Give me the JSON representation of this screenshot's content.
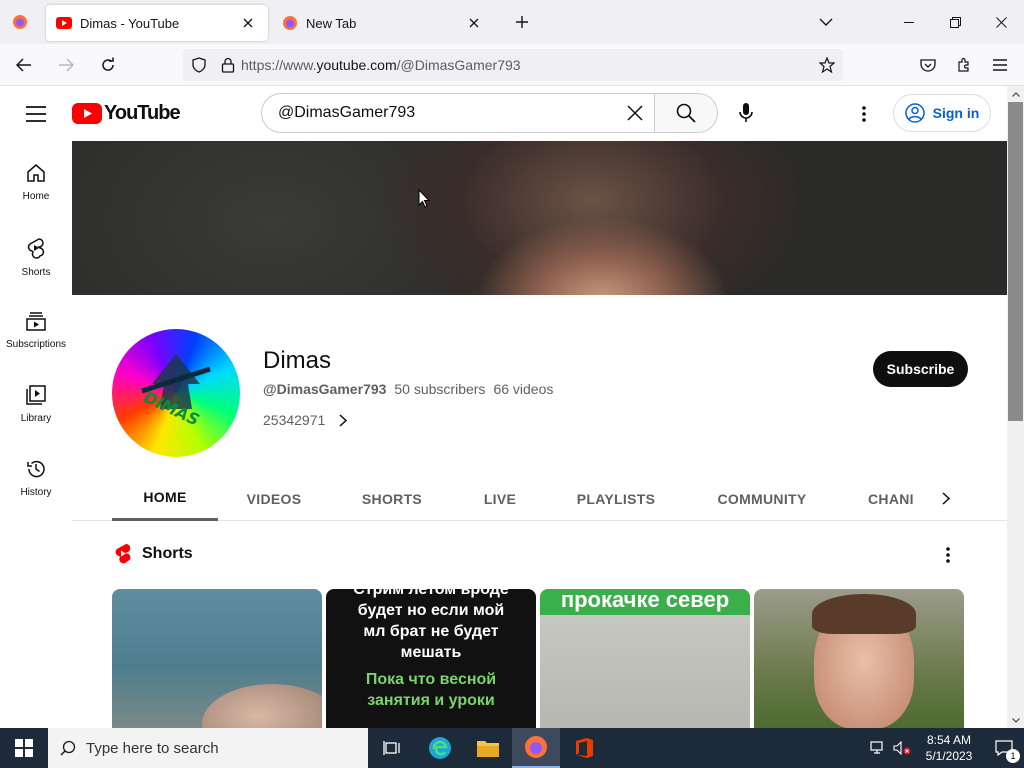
{
  "browser": {
    "tabs": [
      {
        "title": "Dimas - YouTube",
        "active": true
      },
      {
        "title": "New Tab",
        "active": false
      }
    ],
    "url": {
      "prefix": "https://www.",
      "domain": "youtube.com",
      "path": "/@DimasGamer793"
    }
  },
  "youtube": {
    "logo_text": "YouTube",
    "search_query": "@DimasGamer793",
    "signin_label": "Sign in",
    "guide": [
      {
        "label": "Home",
        "icon": "home-icon"
      },
      {
        "label": "Shorts",
        "icon": "shorts-icon"
      },
      {
        "label": "Subscriptions",
        "icon": "subscriptions-icon"
      },
      {
        "label": "Library",
        "icon": "library-icon"
      },
      {
        "label": "History",
        "icon": "history-icon"
      }
    ],
    "channel": {
      "name": "Dimas",
      "handle": "@DimasGamer793",
      "subscribers": "50 subscribers",
      "videos": "66 videos",
      "description": "25342971",
      "avatar_text": "DIMAS",
      "subscribe_label": "Subscribe"
    },
    "tabs": [
      {
        "label": "HOME",
        "active": true
      },
      {
        "label": "VIDEOS"
      },
      {
        "label": "SHORTS"
      },
      {
        "label": "LIVE"
      },
      {
        "label": "PLAYLISTS"
      },
      {
        "label": "COMMUNITY"
      },
      {
        "label": "CHANI"
      }
    ],
    "shorts_shelf": {
      "title": "Shorts",
      "cards": [
        {
          "text": ""
        },
        {
          "text_lines": [
            "Стрим летом вроде",
            "будет но если мой",
            "мл брат не будет",
            "мешать"
          ],
          "green_lines": [
            "Пока что весной",
            "занятия и уроки"
          ]
        },
        {
          "caption": "прокачке север"
        },
        {
          "text": ""
        }
      ]
    }
  },
  "taskbar": {
    "search_placeholder": "Type here to search",
    "time": "8:54 AM",
    "date": "5/1/2023",
    "notification_count": "1"
  },
  "colors": {
    "yt_red": "#ff0000",
    "link_blue": "#065fd4",
    "taskbar_bg": "#1c2a3a"
  }
}
